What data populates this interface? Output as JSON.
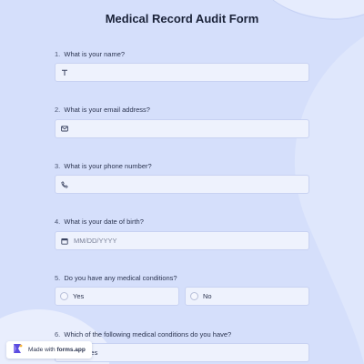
{
  "form": {
    "title": "Medical Record Audit Form"
  },
  "questions": [
    {
      "number": "1.",
      "label": "What is your name?",
      "icon": "text-icon",
      "placeholder": ""
    },
    {
      "number": "2.",
      "label": "What is your email address?",
      "icon": "envelope-icon",
      "placeholder": ""
    },
    {
      "number": "3.",
      "label": "What is your phone number?",
      "icon": "phone-icon",
      "placeholder": ""
    },
    {
      "number": "4.",
      "label": "What is your date of birth?",
      "icon": "calendar-icon",
      "placeholder": "MM/DD/YYYY"
    },
    {
      "number": "5.",
      "label": "Do you have any medical conditions?",
      "options": [
        "Yes",
        "No"
      ]
    },
    {
      "number": "6.",
      "label": "Which of the following medical conditions do you have?",
      "visible_option": "betes"
    }
  ],
  "badge": {
    "prefix": "Made with",
    "brand": "forms.app"
  },
  "colors": {
    "background": "#d5dffb",
    "field_background": "#eef2fd",
    "field_border": "#c8d2f2",
    "brand_accent": "#5b4de0"
  }
}
